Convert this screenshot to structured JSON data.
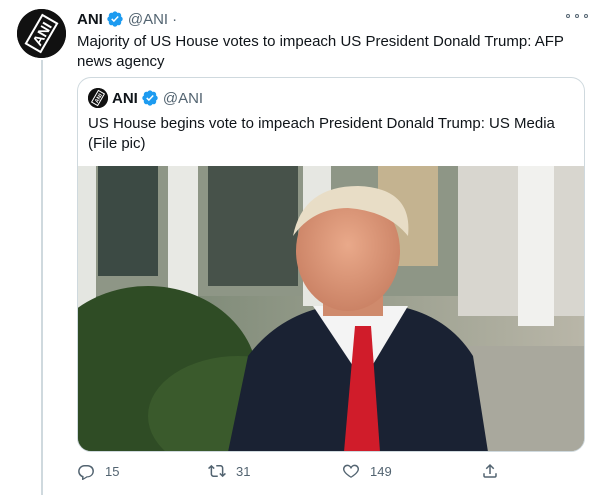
{
  "tweet": {
    "name": "ANI",
    "handle": "@ANI",
    "separator": "·",
    "text": "Majority of US House votes to impeach US President Donald Trump: AFP news agency"
  },
  "quoted_tweet": {
    "name": "ANI",
    "handle": "@ANI",
    "text": "US House begins vote to impeach President Donald Trump: US Media (File pic)"
  },
  "avatar_logo_text": "ANI",
  "actions": {
    "reply_count": "15",
    "retweet_count": "31",
    "like_count": "149"
  },
  "icons": [
    "verified-badge-icon",
    "more-icon",
    "reply-icon",
    "retweet-icon",
    "like-icon",
    "share-icon"
  ],
  "colors": {
    "verified": "#1d9bf0",
    "secondary_text": "#536471",
    "border": "#cfd9de",
    "primary_text": "#0f1419"
  }
}
